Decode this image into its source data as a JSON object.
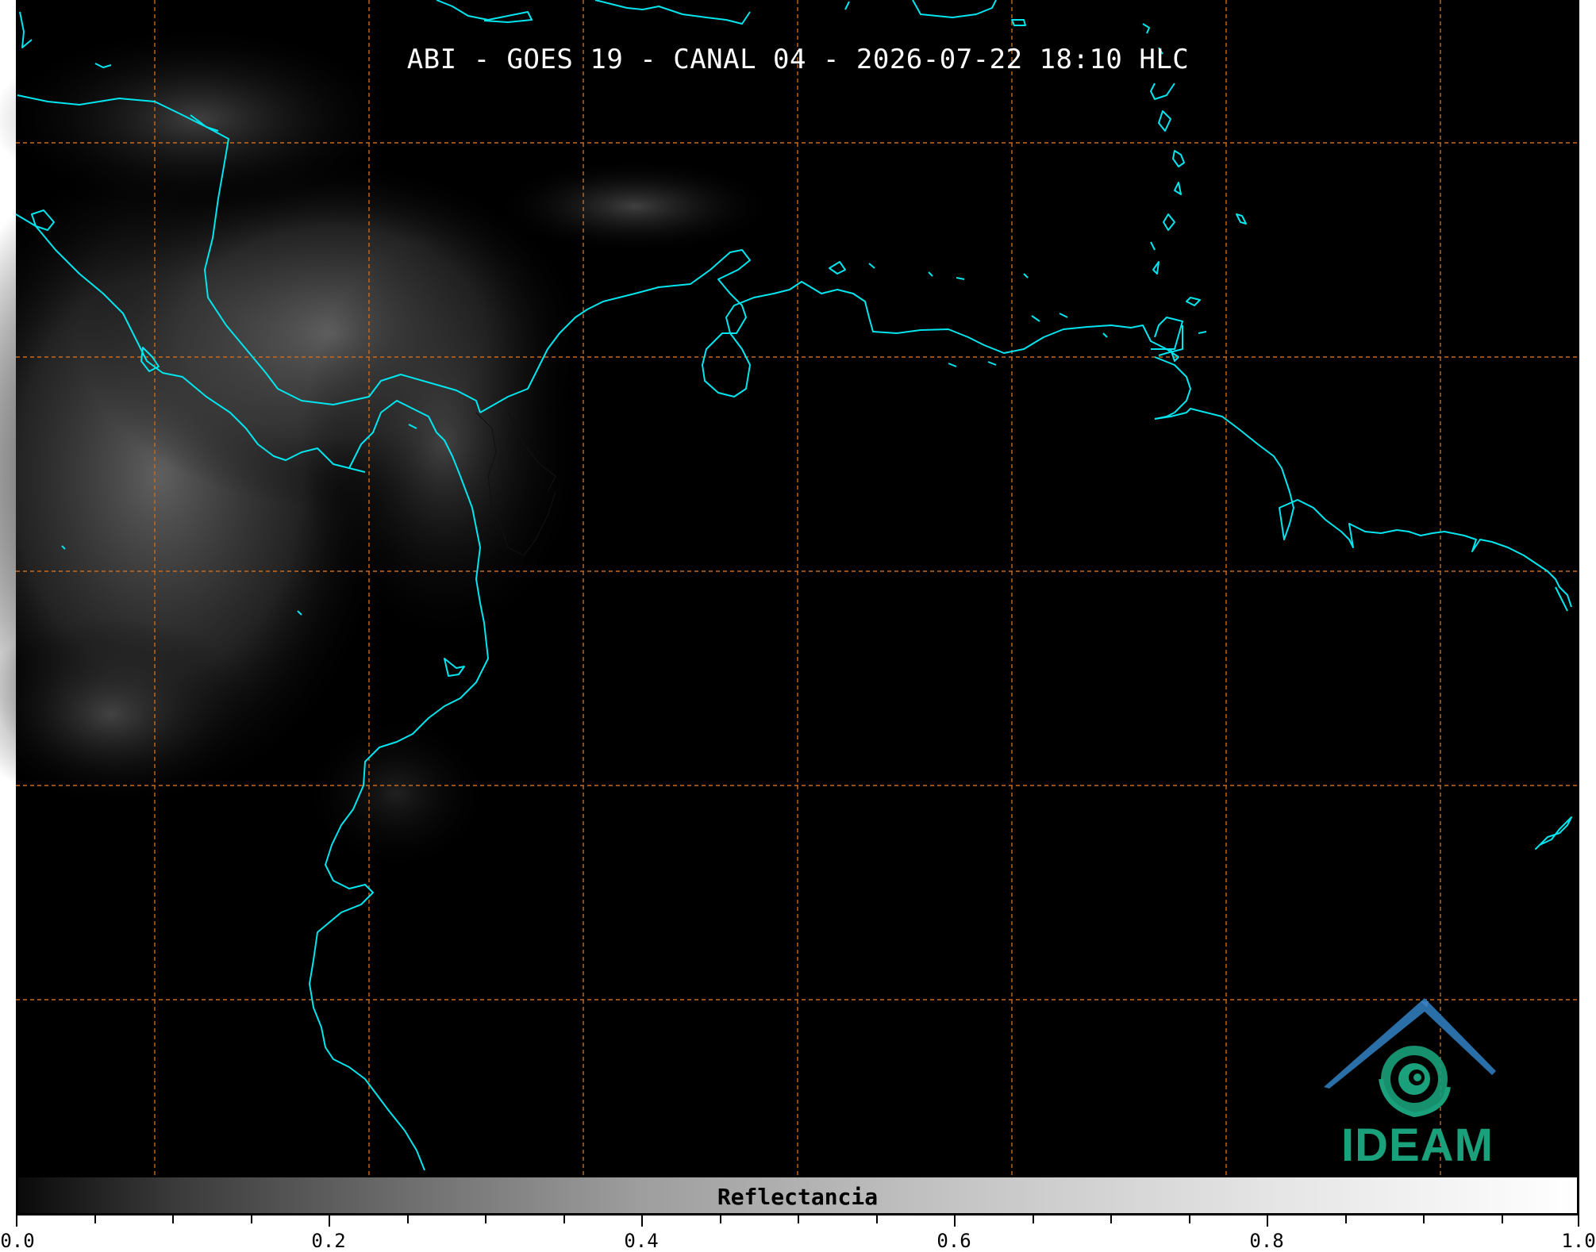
{
  "title": "ABI - GOES 19 - CANAL 04 - 2026-07-22 18:10 HLC",
  "colorbar": {
    "label": "Reflectancia",
    "range": [
      0.0,
      1.0
    ],
    "tick_labels": [
      "0.0",
      "0.2",
      "0.4",
      "0.6",
      "0.8",
      "1.0"
    ],
    "minor_step": 0.05
  },
  "logo": {
    "text": "IDEAM"
  },
  "colors": {
    "coastline": "#00e5ee",
    "grid": "#c86a1e",
    "background": "#000000"
  }
}
